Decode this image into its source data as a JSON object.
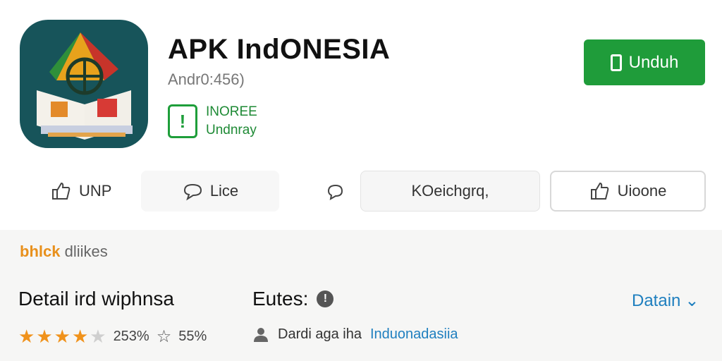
{
  "app": {
    "title": "APK IndONESIA",
    "subtitle": "Andr0:456)",
    "badge_line1": "INOREE",
    "badge_line2": "Undnray",
    "badge_icon_glyph": "!"
  },
  "download_button": {
    "label": "Unduh"
  },
  "actions": {
    "like_label": "UNP",
    "comment_label": "Lice",
    "middle_label": "KOeichgrq,",
    "thumb_label": "Uioone"
  },
  "section": {
    "label_orange": "bhlck",
    "label_grey": "dliikes"
  },
  "details": {
    "title": "Detail ird wiphnsa",
    "rating_percent": "253%",
    "rating_value": 4.5,
    "secondary_percent": "55%"
  },
  "features": {
    "title": "Eutes:",
    "info_glyph": "!",
    "developer_name": "Dardi aga iha",
    "developer_link": "Induonadasiia"
  },
  "detail_link": {
    "label": "Datain",
    "chevron": "⌄"
  },
  "colors": {
    "accent_green": "#1f9c3a",
    "star_orange": "#f0921b",
    "link_blue": "#1f7fbf",
    "icon_teal": "#17545a"
  }
}
